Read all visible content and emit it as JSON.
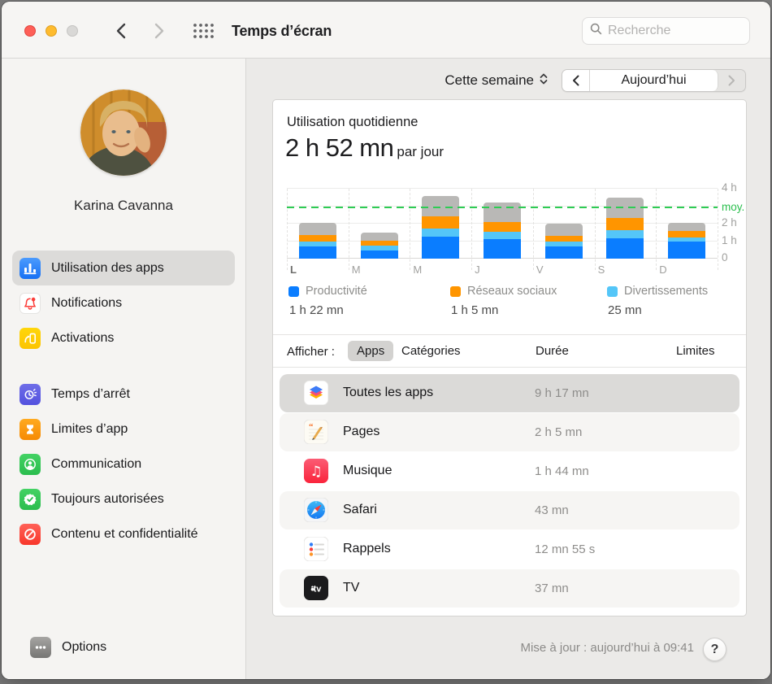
{
  "window": {
    "title": "Temps d’écran"
  },
  "titlebar": {
    "search_placeholder": "Recherche"
  },
  "sidebar": {
    "user_name": "Karina Cavanna",
    "items": [
      {
        "label": "Utilisation des apps"
      },
      {
        "label": "Notifications"
      },
      {
        "label": "Activations"
      },
      {
        "label": "Temps d’arrêt"
      },
      {
        "label": "Limites d’app"
      },
      {
        "label": "Communication"
      },
      {
        "label": "Toujours autorisées"
      },
      {
        "label": "Contenu et confidentialité"
      }
    ],
    "options_label": "Options"
  },
  "toolbar": {
    "period": "Cette semaine",
    "today": "Aujourd’hui"
  },
  "usage": {
    "title": "Utilisation quotidienne",
    "value": "2 h 52 mn",
    "suffix": "par jour"
  },
  "legend": [
    {
      "name": "Productivité",
      "total": "1 h 22 mn",
      "color": "#0a7dff"
    },
    {
      "name": "Réseaux sociaux",
      "total": "1 h 5 mn",
      "color": "#ff9500"
    },
    {
      "name": "Divertissements",
      "total": "25 mn",
      "color": "#54c6f8"
    }
  ],
  "filter": {
    "label": "Afficher :",
    "tab_apps": "Apps",
    "tab_categories": "Catégories",
    "col_duration": "Durée",
    "col_limits": "Limites"
  },
  "apps": [
    {
      "name": "Toutes les apps",
      "duration": "9 h 17 mn"
    },
    {
      "name": "Pages",
      "duration": "2 h 5 mn"
    },
    {
      "name": "Musique",
      "duration": "1 h 44 mn"
    },
    {
      "name": "Safari",
      "duration": "43 mn"
    },
    {
      "name": "Rappels",
      "duration": "12 mn 55 s"
    },
    {
      "name": "TV",
      "duration": "37 mn"
    }
  ],
  "footer": {
    "updated": "Mise à jour : aujourd’hui à 09:41",
    "help_label": "?"
  },
  "chart_data": {
    "type": "stacked-bar",
    "categories": [
      "L",
      "M",
      "M",
      "J",
      "V",
      "S",
      "D"
    ],
    "highlight_category_index": 0,
    "series": [
      {
        "name": "Productivité",
        "color": "#0a7dff",
        "values": [
          0.7,
          0.47,
          1.27,
          1.1,
          0.7,
          1.16,
          0.98
        ]
      },
      {
        "name": "Divertissements",
        "color": "#54c6f8",
        "values": [
          0.28,
          0.26,
          0.46,
          0.43,
          0.26,
          0.46,
          0.23
        ]
      },
      {
        "name": "Réseaux sociaux",
        "color": "#ff9500",
        "values": [
          0.35,
          0.28,
          0.67,
          0.55,
          0.36,
          0.7,
          0.35
        ]
      },
      {
        "name": "Autres",
        "color": "#b9b8b6",
        "values": [
          0.7,
          0.5,
          1.2,
          1.12,
          0.7,
          1.18,
          0.47
        ]
      }
    ],
    "average_line": {
      "value": 2.87,
      "label": "moy.",
      "color": "#2ecc54"
    },
    "ylim": [
      0,
      4
    ],
    "gridlines": [
      0,
      1,
      2,
      3,
      4
    ],
    "yticks": [
      {
        "value": 4,
        "label": "4 h"
      },
      {
        "value": 2,
        "label": "2 h"
      },
      {
        "value": 1,
        "label": "1 h"
      },
      {
        "value": 0,
        "label": "0"
      }
    ],
    "legend_position": "bottom",
    "grid": true
  }
}
